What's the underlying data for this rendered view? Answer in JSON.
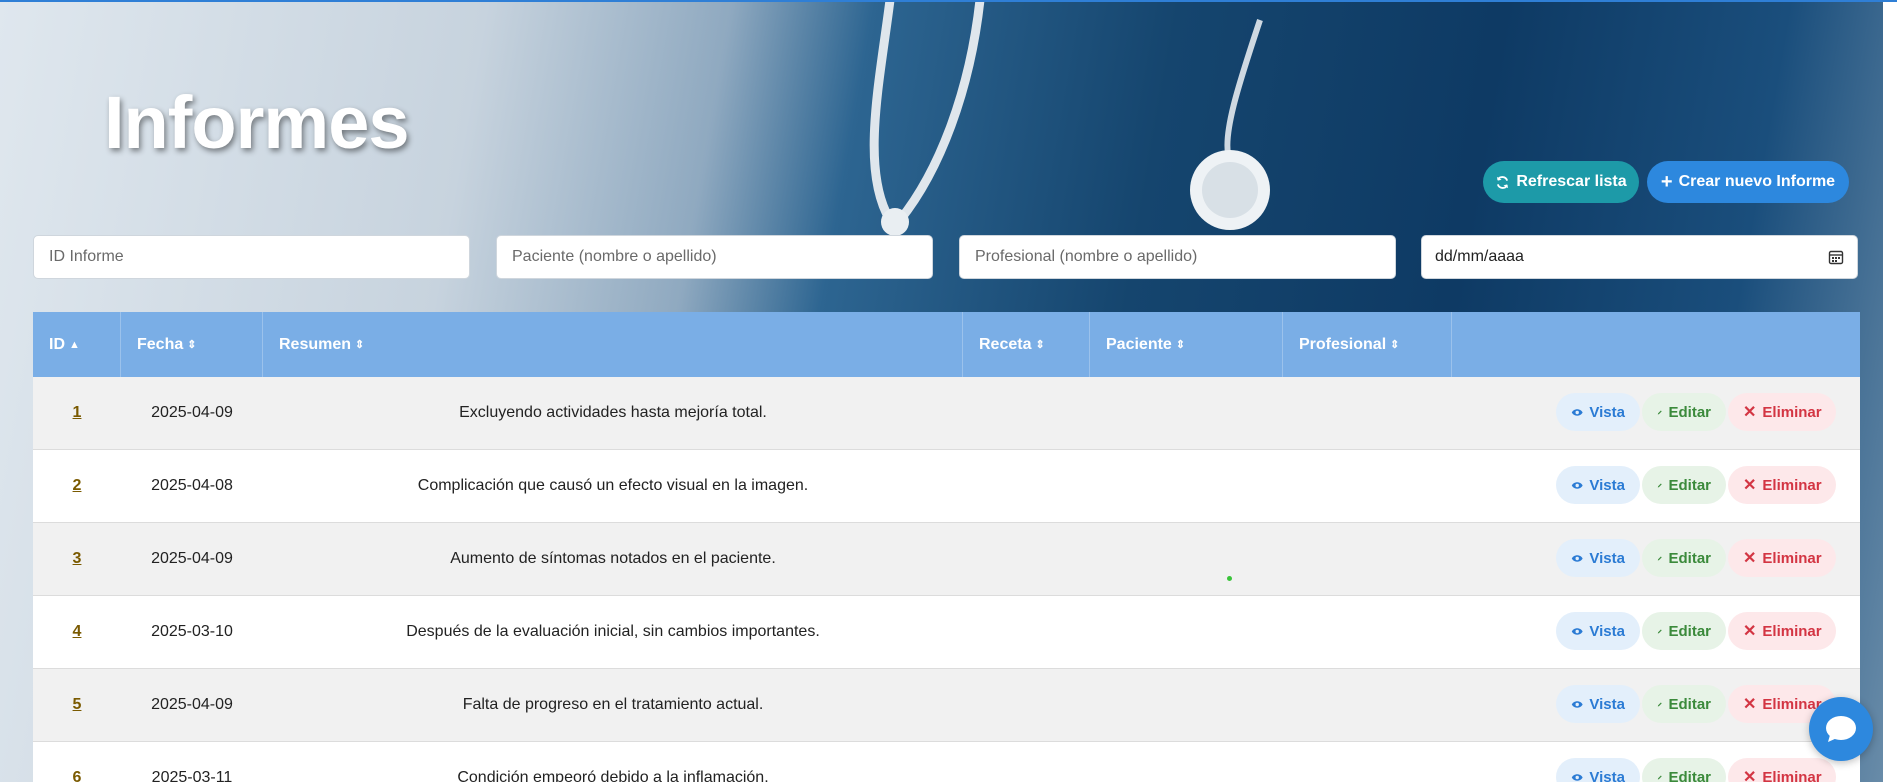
{
  "header": {
    "title": "Informes"
  },
  "buttons": {
    "refresh": "Refrescar lista",
    "create": "Crear nuevo Informe"
  },
  "filters": {
    "id_placeholder": "ID Informe",
    "patient_placeholder": "Paciente (nombre o apellido)",
    "professional_placeholder": "Profesional (nombre o apellido)",
    "date_value": "dd/mm/aaaa"
  },
  "table": {
    "columns": [
      "ID",
      "Fecha",
      "Resumen",
      "Receta",
      "Paciente",
      "Profesional"
    ],
    "action_labels": {
      "view": "Vista",
      "edit": "Editar",
      "delete": "Eliminar"
    },
    "rows": [
      {
        "id": "1",
        "fecha": "2025-04-09",
        "resumen": "Excluyendo actividades hasta mejoría total."
      },
      {
        "id": "2",
        "fecha": "2025-04-08",
        "resumen": "Complicación que causó un efecto visual en la imagen."
      },
      {
        "id": "3",
        "fecha": "2025-04-09",
        "resumen": "Aumento de síntomas notados en el paciente."
      },
      {
        "id": "4",
        "fecha": "2025-03-10",
        "resumen": "Después de la evaluación inicial, sin cambios importantes."
      },
      {
        "id": "5",
        "fecha": "2025-04-09",
        "resumen": "Falta de progreso en el tratamiento actual."
      },
      {
        "id": "6",
        "fecha": "2025-03-11",
        "resumen": "Condición empeoró debido a la inflamación."
      }
    ]
  },
  "colors": {
    "header_bg": "#7aaee6",
    "view": "#2b7bd4",
    "edit": "#3b8a3b",
    "delete": "#d33543",
    "accent": "#2d88de",
    "teal": "#1d9aa8"
  }
}
